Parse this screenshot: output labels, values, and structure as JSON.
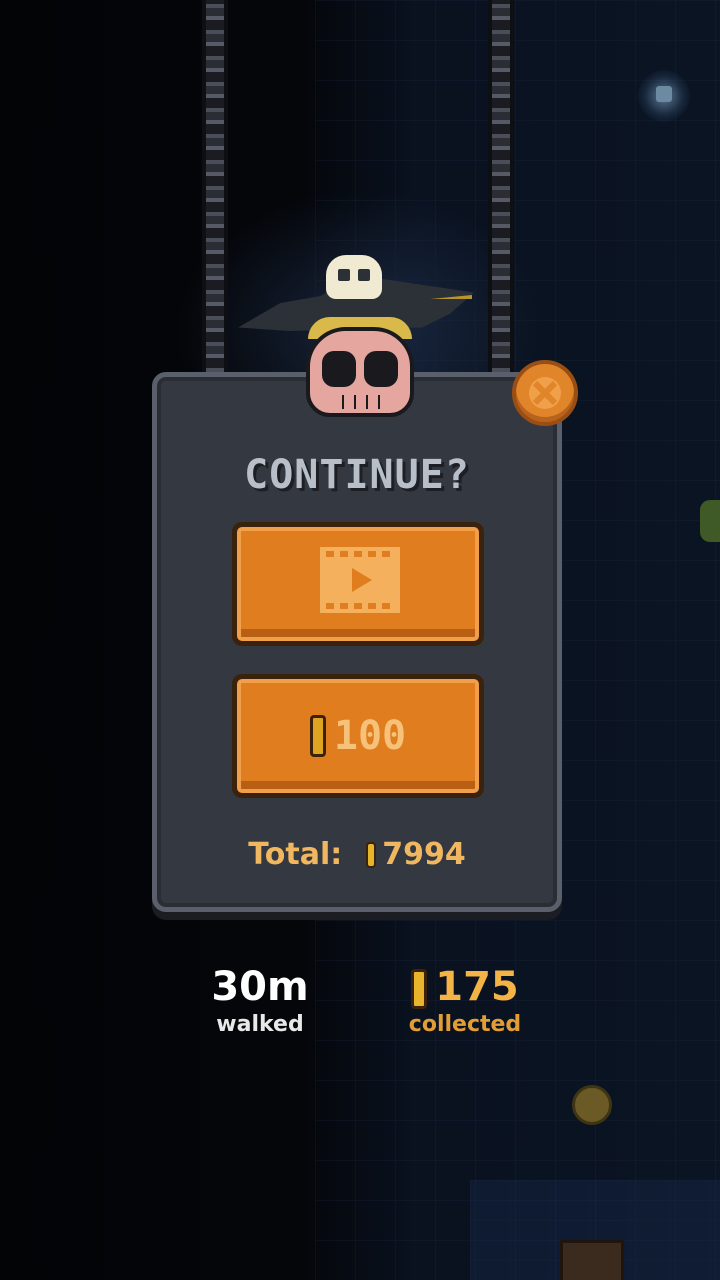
{
  "dialog": {
    "title": "CONTINUE?",
    "video_button_icon": "film-play-icon",
    "coin_button_cost": "100",
    "total_label": "Total:",
    "total_value": "7994"
  },
  "stats": {
    "distance_value": "30m",
    "distance_label": "walked",
    "coins_value": "175",
    "coins_label": "collected"
  },
  "colors": {
    "button_orange": "#e07d1f",
    "panel_gray": "#343840",
    "coin_gold": "#e8b42c"
  }
}
